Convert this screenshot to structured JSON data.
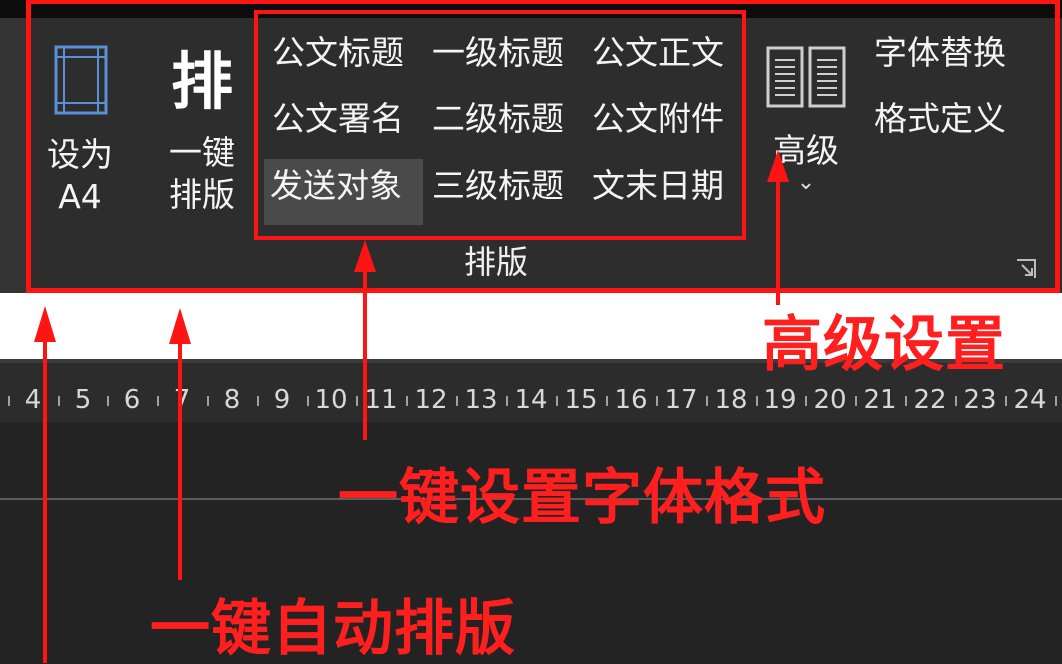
{
  "ribbon": {
    "set_a4": {
      "line1": "设为",
      "line2": "A4"
    },
    "one_key_layout": {
      "glyph": "排",
      "line1": "一键",
      "line2": "排版"
    },
    "styles": [
      {
        "label": "公文标题"
      },
      {
        "label": "一级标题"
      },
      {
        "label": "公文正文"
      },
      {
        "label": "公文署名"
      },
      {
        "label": "二级标题"
      },
      {
        "label": "公文附件"
      },
      {
        "label": "发送对象",
        "selected": true
      },
      {
        "label": "三级标题"
      },
      {
        "label": "文末日期"
      }
    ],
    "advanced": {
      "label": "高级",
      "chevron": "⌄"
    },
    "font_replace": "字体替换",
    "format_define": "格式定义",
    "group_label": "排版"
  },
  "ruler": {
    "numbers": [
      "4",
      "5",
      "6",
      "7",
      "8",
      "9",
      "10",
      "11",
      "12",
      "13",
      "14",
      "15",
      "16",
      "17",
      "18",
      "19",
      "20",
      "21",
      "22",
      "23",
      "24"
    ]
  },
  "annotations": {
    "advanced_settings": "高级设置",
    "one_key_font_format": "一键设置字体格式",
    "one_key_auto_layout": "一键自动排版"
  },
  "colors": {
    "annotation_red": "#ff1414",
    "ribbon_bg": "#2d2d2d"
  }
}
